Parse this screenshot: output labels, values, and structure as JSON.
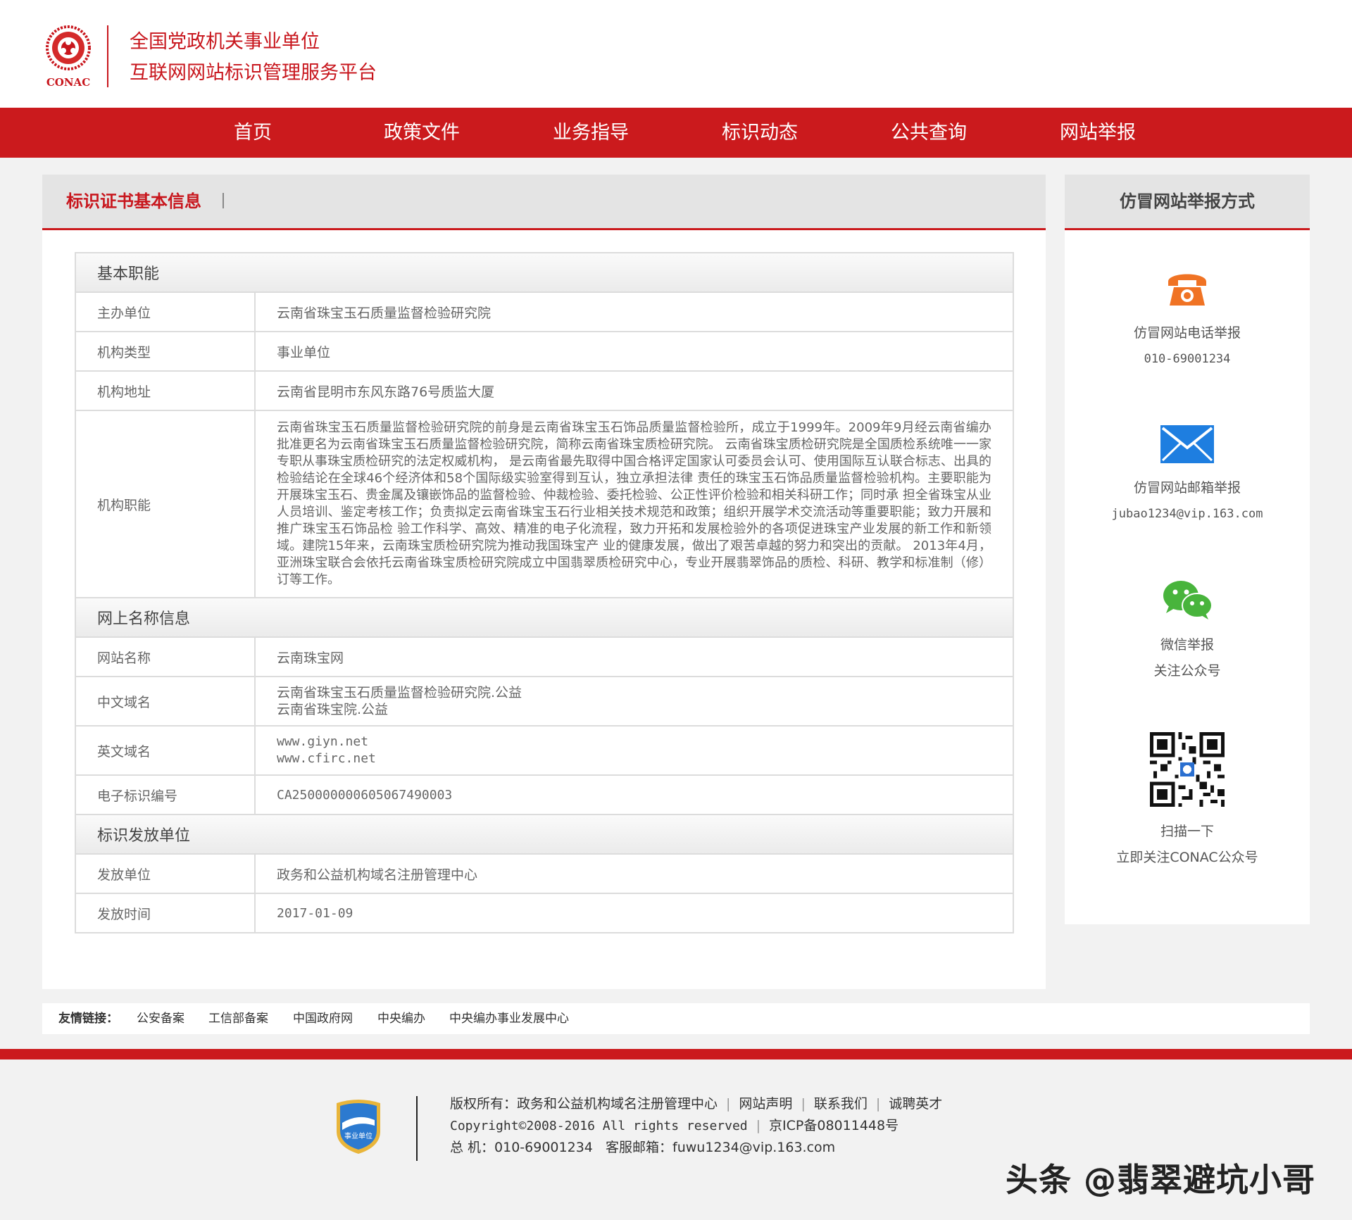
{
  "header": {
    "logo_text": "CONAC",
    "title_line1": "全国党政机关事业单位",
    "title_line2": "互联网网站标识管理服务平台"
  },
  "nav": {
    "items": [
      "首页",
      "政策文件",
      "业务指导",
      "标识动态",
      "公共查询",
      "网站举报"
    ]
  },
  "main": {
    "panel_title": "标识证书基本信息",
    "sections": {
      "basic": {
        "title": "基本职能",
        "sponsor_label": "主办单位",
        "sponsor_value": "云南省珠宝玉石质量监督检验研究院",
        "type_label": "机构类型",
        "type_value": "事业单位",
        "address_label": "机构地址",
        "address_value": "云南省昆明市东风东路76号质监大厦",
        "duty_label": "机构职能",
        "duty_value": "云南省珠宝玉石质量监督检验研究院的前身是云南省珠宝玉石饰品质量监督检验所，成立于1999年。2009年9月经云南省编办批准更名为云南省珠宝玉石质量监督检验研究院，简称云南省珠宝质检研究院。 云南省珠宝质检研究院是全国质检系统唯一一家专职从事珠宝质检研究的法定权威机构， 是云南省最先取得中国合格评定国家认可委员会认可、使用国际互认联合标志、出具的检验结论在全球46个经济体和58个国际级实验室得到互认，独立承担法律 责任的珠宝玉石饰品质量监督检验机构。主要职能为开展珠宝玉石、贵金属及镶嵌饰品的监督检验、仲裁检验、委托检验、公正性评价检验和相关科研工作；同时承 担全省珠宝从业人员培训、鉴定考核工作；负责拟定云南省珠宝玉石行业相关技术规范和政策；组织开展学术交流活动等重要职能；致力开展和推广珠宝玉石饰品检 验工作科学、高效、精准的电子化流程，致力开拓和发展检验外的各项促进珠宝产业发展的新工作和新领域。建院15年来，云南珠宝质检研究院为推动我国珠宝产 业的健康发展，做出了艰苦卓越的努力和突出的贡献。 2013年4月，亚洲珠宝联合会依托云南省珠宝质检研究院成立中国翡翠质检研究中心，专业开展翡翠饰品的质检、科研、教学和标准制（修）订等工作。"
      },
      "online": {
        "title": "网上名称信息",
        "site_name_label": "网站名称",
        "site_name_value": "云南珠宝网",
        "cn_domain_label": "中文域名",
        "cn_domain_value1": "云南省珠宝玉石质量监督检验研究院.公益",
        "cn_domain_value2": "云南省珠宝院.公益",
        "en_domain_label": "英文域名",
        "en_domain_value1": "www.giyn.net",
        "en_domain_value2": "www.cfirc.net",
        "id_label": "电子标识编号",
        "id_value": "CA250000000605067490003"
      },
      "issuer": {
        "title": "标识发放单位",
        "issuer_label": "发放单位",
        "issuer_value": "政务和公益机构域名注册管理中心",
        "date_label": "发放时间",
        "date_value": "2017-01-09"
      }
    }
  },
  "sidebar": {
    "title": "仿冒网站举报方式",
    "phone": {
      "label": "仿冒网站电话举报",
      "value": "010-69001234"
    },
    "email": {
      "label": "仿冒网站邮箱举报",
      "value": "jubao1234@vip.163.com"
    },
    "wechat": {
      "label": "微信举报",
      "value": "关注公众号"
    },
    "qr": {
      "label": "扫描一下",
      "value": "立即关注CONAC公众号"
    }
  },
  "links": {
    "label": "友情链接：",
    "items": [
      "公安备案",
      "工信部备案",
      "中国政府网",
      "中央编办",
      "中央编办事业发展中心"
    ]
  },
  "footer": {
    "badge_text": "事业单位",
    "copyright_label": "版权所有：政务和公益机构域名注册管理中心",
    "link_statement": "网站声明",
    "link_contact": "联系我们",
    "link_jobs": "诚聘英才",
    "copyright_line": "Copyright©2008-2016 All rights reserved",
    "icp": "京ICP备08011448号",
    "phone_line": "总 机：010-69001234",
    "email_line": "客服邮箱：fuwu1234@vip.163.com"
  },
  "watermark": "头条 @翡翠避坑小哥",
  "colors": {
    "brand_red": "#cb1a1d",
    "phone_icon": "#f07324",
    "email_icon": "#1e7ee0",
    "wechat_icon": "#48b43c"
  }
}
